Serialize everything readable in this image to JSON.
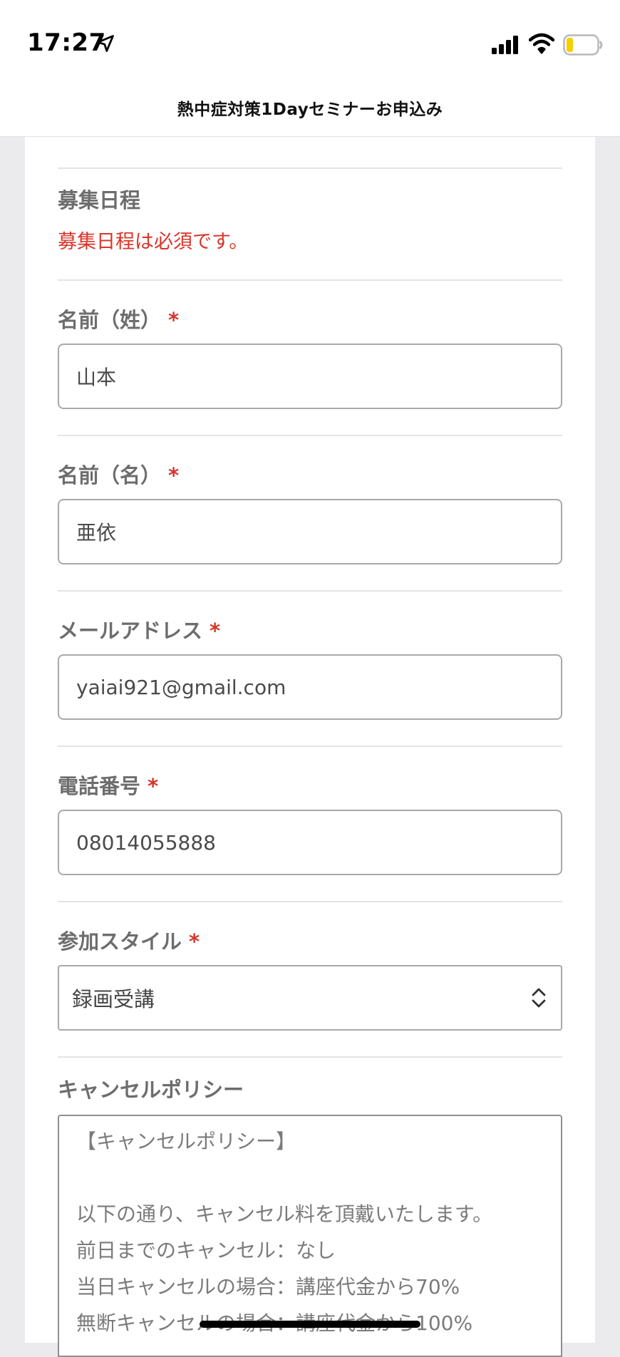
{
  "status_bar": {
    "time": "17:27",
    "icons": [
      "location-arrow-icon",
      "cellular-signal-icon",
      "wifi-icon",
      "battery-low-icon"
    ],
    "battery_color": "#f5d000"
  },
  "nav": {
    "title": "熱中症対策1Dayセミナーお申込み"
  },
  "form": {
    "schedule": {
      "label": "募集日程",
      "error": "募集日程は必須です。"
    },
    "last_name": {
      "label": "名前（姓）",
      "required_mark": "*",
      "value": "山本"
    },
    "first_name": {
      "label": "名前（名）",
      "required_mark": "*",
      "value": "亜依"
    },
    "email": {
      "label": "メールアドレス",
      "required_mark": "*",
      "value": "yaiai921@gmail.com"
    },
    "phone": {
      "label": "電話番号",
      "required_mark": "*",
      "value": "08014055888"
    },
    "style": {
      "label": "参加スタイル",
      "required_mark": "*",
      "selected": "録画受講"
    },
    "policy": {
      "label": "キャンセルポリシー",
      "lines": [
        "【キャンセルポリシー】",
        "",
        "以下の通り、キャンセル料を頂戴いたします。",
        "前日までのキャンセル：なし",
        "当日キャンセルの場合：講座代金から70%",
        "無断キャンセルの場合：講座代金から100%"
      ]
    }
  },
  "colors": {
    "error": "#d9352b",
    "label": "#6d6d6d",
    "background": "#ebebee"
  }
}
